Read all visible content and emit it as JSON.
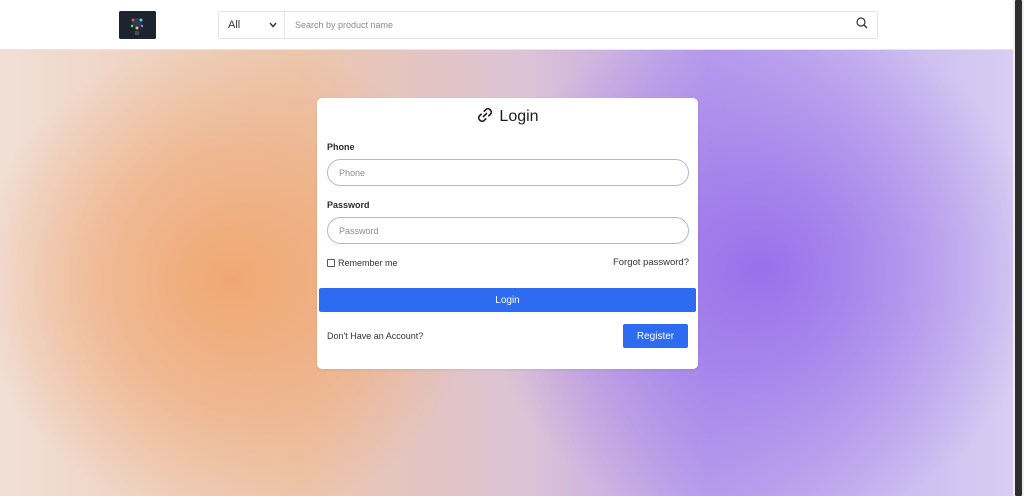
{
  "header": {
    "search": {
      "category": "All",
      "placeholder": "Search by product name"
    }
  },
  "login": {
    "title": "Login",
    "phone_label": "Phone",
    "phone_placeholder": "Phone",
    "password_label": "Password",
    "password_placeholder": "Password",
    "remember_label": "Remember me",
    "forgot_label": "Forgot password?",
    "submit_label": "Login",
    "no_account_text": "Don't Have an Account?",
    "register_label": "Register"
  },
  "colors": {
    "primary": "#2d6bf0",
    "input_border": "#aab6e8"
  },
  "icons": {
    "title_icon": "link-icon",
    "search_icon": "search-icon",
    "category_icon": "chevron-down-icon"
  }
}
